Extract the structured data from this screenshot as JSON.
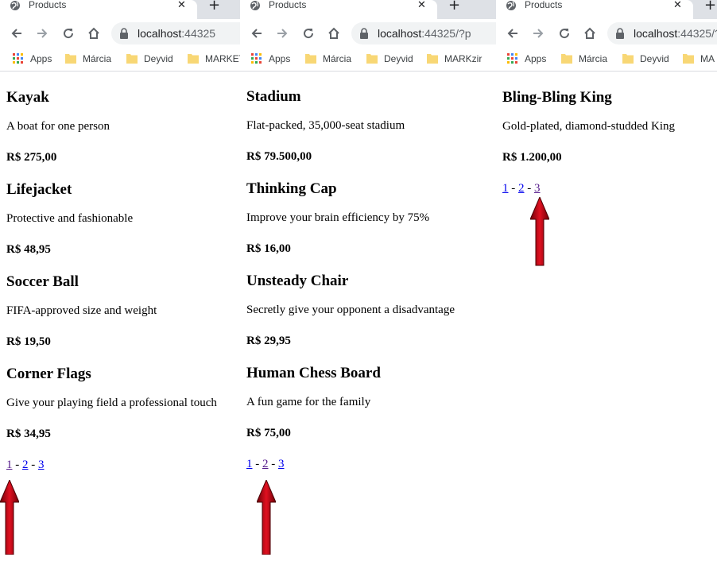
{
  "browser": {
    "tab_title": "Products",
    "new_tab": "+",
    "close": "✕",
    "bookmarks": [
      "Apps",
      "Márcia",
      "Deyvid",
      "MARKET"
    ]
  },
  "panels": [
    {
      "url_host": "localhost",
      "url_rest": ":44325",
      "bookmark_last": "MARKET",
      "products": [
        {
          "name": "Kayak",
          "description": "A boat for one person",
          "price": "R$ 275,00"
        },
        {
          "name": "Lifejacket",
          "description": "Protective and fashionable",
          "price": "R$ 48,95"
        },
        {
          "name": "Soccer Ball",
          "description": "FIFA-approved size and weight",
          "price": "R$ 19,50"
        },
        {
          "name": "Corner Flags",
          "description": "Give your playing field a professional touch",
          "price": "R$ 34,95"
        }
      ],
      "pages": [
        "1",
        "2",
        "3"
      ],
      "current_page": "1"
    },
    {
      "url_host": "localhost",
      "url_rest": ":44325/?p",
      "bookmark_last": "MARKzir",
      "products": [
        {
          "name": "Stadium",
          "description": "Flat-packed, 35,000-seat stadium",
          "price": "R$ 79.500,00"
        },
        {
          "name": "Thinking Cap",
          "description": "Improve your brain efficiency by 75%",
          "price": "R$ 16,00"
        },
        {
          "name": "Unsteady Chair",
          "description": "Secretly give your opponent a disadvantage",
          "price": "R$ 29,95"
        },
        {
          "name": "Human Chess Board",
          "description": "A fun game for the family",
          "price": "R$ 75,00"
        }
      ],
      "pages": [
        "1",
        "2",
        "3"
      ],
      "current_page": "2"
    },
    {
      "url_host": "localhost",
      "url_rest": ":44325/?",
      "bookmark_last": "MA",
      "products": [
        {
          "name": "Bling-Bling King",
          "description": "Gold-plated, diamond-studded King",
          "price": "R$ 1.200,00"
        }
      ],
      "pages": [
        "1",
        "2",
        "3"
      ],
      "current_page": "3"
    }
  ],
  "pager_separator": " - ",
  "colors": {
    "link": "#0000ee",
    "visited_link": "#551a8b",
    "arrow": "#b8000f",
    "folder": "#f8d775"
  }
}
